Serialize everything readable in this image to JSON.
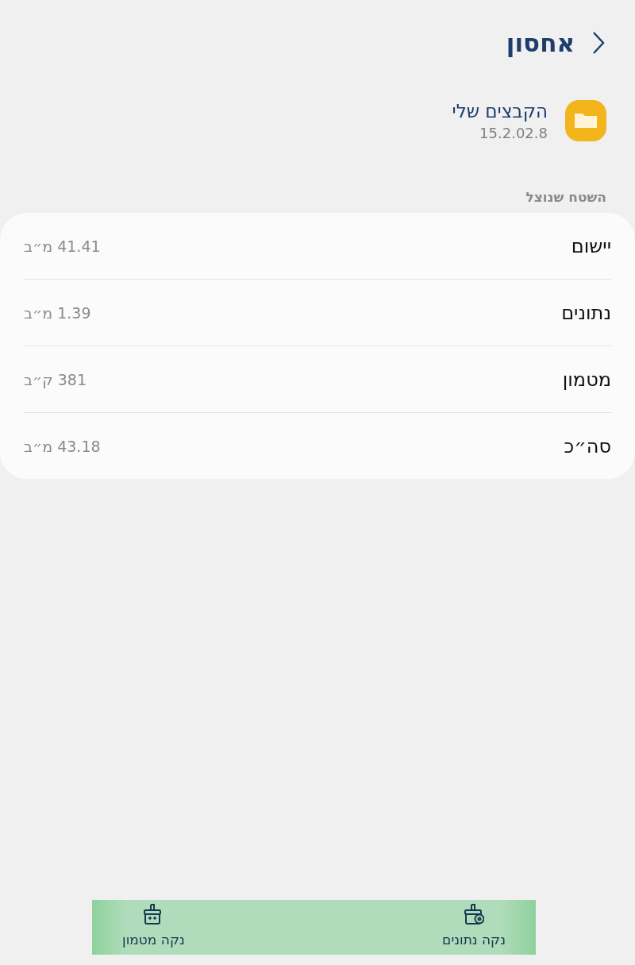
{
  "header": {
    "title": "אחסון"
  },
  "app": {
    "name": "הקבצים שלי",
    "version": "15.2.02.8"
  },
  "section_label": "השטח שנוצל",
  "usage": [
    {
      "label": "יישום",
      "value": "41.41 מ״ב"
    },
    {
      "label": "נתונים",
      "value": "1.39 מ״ב"
    },
    {
      "label": "מטמון",
      "value": "381 ק״ב"
    },
    {
      "label": "סה״כ",
      "value": "43.18 מ״ב"
    }
  ],
  "actions": [
    {
      "kind": "data",
      "label": "נקה נתונים"
    },
    {
      "kind": "cache",
      "label": "נקה מטמון"
    }
  ]
}
